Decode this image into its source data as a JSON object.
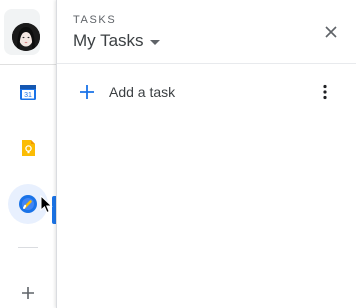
{
  "user": {
    "avatar_icon": "user-avatar"
  },
  "rail": {
    "items": [
      {
        "name": "calendar",
        "icon": "calendar-icon",
        "label": "31",
        "color": "#1a73e8"
      },
      {
        "name": "keep",
        "icon": "keep-icon",
        "color": "#fbbc04"
      },
      {
        "name": "tasks",
        "icon": "tasks-icon",
        "color": "#1a73e8",
        "active": true
      }
    ],
    "add_icon": "plus-icon"
  },
  "panel": {
    "app_title": "TASKS",
    "list_name": "My Tasks",
    "close_icon": "close-icon",
    "add_task_label": "Add a task",
    "add_icon": "plus-icon",
    "more_icon": "more-vert-icon"
  },
  "colors": {
    "accent": "#1a73e8",
    "text": "#3c4043",
    "muted": "#5f6368"
  }
}
